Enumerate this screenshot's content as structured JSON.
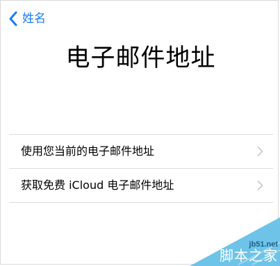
{
  "nav": {
    "back_label": "姓名"
  },
  "page": {
    "title": "电子邮件地址"
  },
  "options": [
    {
      "label": "使用您当前的电子邮件地址"
    },
    {
      "label": "获取免费 iCloud 电子邮件地址"
    }
  ],
  "watermark": {
    "url": "jb51.net",
    "text": "脚本之家"
  },
  "colors": {
    "accent": "#1a7cf7",
    "separator": "#dcdcdc",
    "chevron": "#c7c7cc",
    "watermark_bg": "#6ec3e8"
  },
  "icons": {
    "back": "chevron-left-icon",
    "disclosure": "chevron-right-icon"
  }
}
